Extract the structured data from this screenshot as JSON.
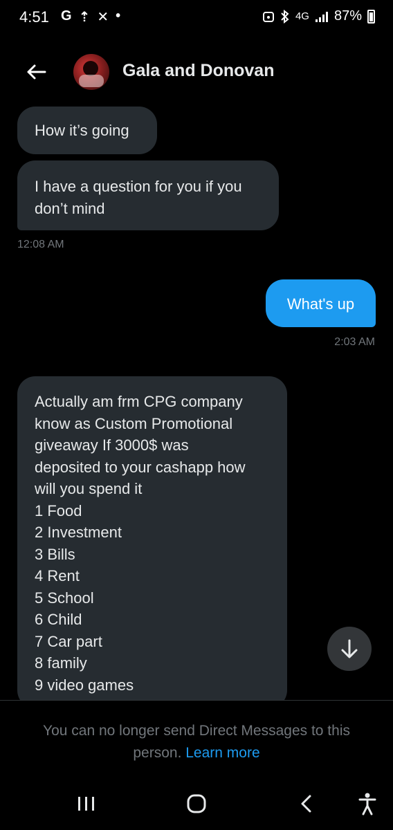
{
  "status_bar": {
    "time": "4:51",
    "left_icons": [
      "G",
      "⇡",
      "✕",
      "•"
    ],
    "network": "4G",
    "battery": "87%"
  },
  "header": {
    "title": "Gala and Donovan"
  },
  "messages": [
    {
      "side": "left",
      "text": "How it’s going"
    },
    {
      "side": "left",
      "text": "I have a question for you if you\ndon’t mind",
      "timestamp": "12:08 AM"
    },
    {
      "side": "right",
      "text": "What's up",
      "timestamp": "2:03 AM"
    },
    {
      "side": "left",
      "text": "Actually am frm CPG company\nknow as Custom Promotional\ngiveaway If 3000$ was\ndeposited to your cashapp how\nwill you spend it\n1 Food\n2 Investment\n3 Bills\n4 Rent\n5 School\n6 Child\n7 Car part\n8 family\n9 video games"
    }
  ],
  "footer": {
    "notice": "You can no longer send Direct Messages to this person.",
    "link": "Learn more"
  },
  "colors": {
    "accent": "#1d9bf0",
    "bubble_incoming": "#262c31",
    "muted_text": "#71767b"
  }
}
